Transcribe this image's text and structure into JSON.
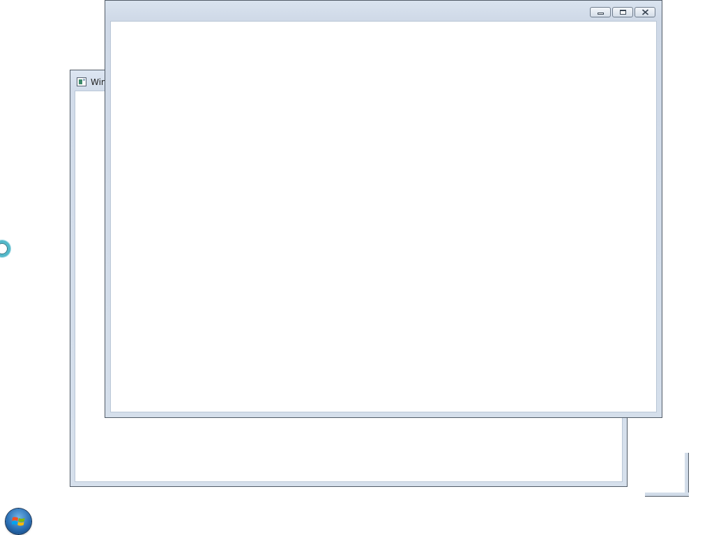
{
  "desktop": {
    "background_color": "#ffffff"
  },
  "back_window": {
    "title": "Win",
    "icon": "app-window-icon"
  },
  "front_window": {
    "title": "",
    "caption_buttons": [
      {
        "name": "minimize",
        "icon": "minimize-icon"
      },
      {
        "name": "maximize",
        "icon": "maximize-icon"
      },
      {
        "name": "close",
        "icon": "close-icon"
      }
    ]
  },
  "cursor": {
    "icon": "busy-cursor-icon",
    "accent": "#52b8c9"
  },
  "taskbar": {
    "start_button": {
      "icon": "windows-start-orb-icon"
    }
  }
}
